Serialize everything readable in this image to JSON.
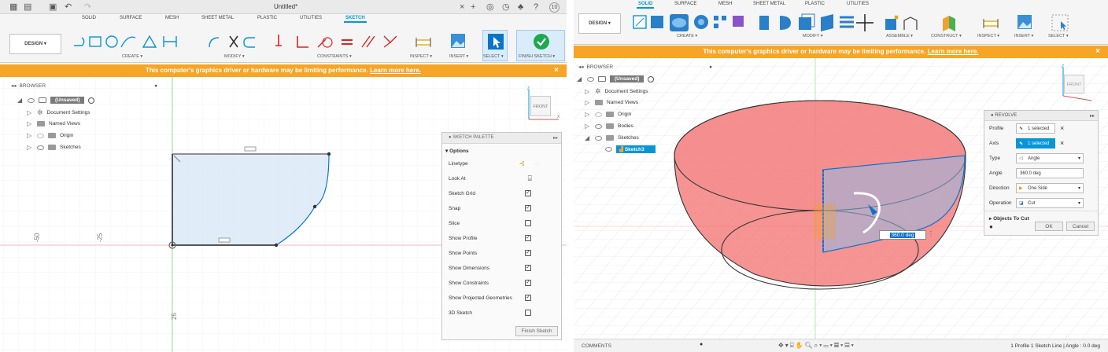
{
  "left": {
    "title": "Untitled*",
    "account": "10",
    "tabs": [
      "SOLID",
      "SURFACE",
      "MESH",
      "SHEET METAL",
      "PLASTIC",
      "UTILITIES",
      "SKETCH"
    ],
    "design_label": "DESIGN ▾",
    "groups": {
      "create": "CREATE ▾",
      "modify": "MODIFY ▾",
      "constraints": "CONSTRAINTS ▾",
      "inspect": "INSPECT ▾",
      "insert": "INSERT ▾",
      "select": "SELECT ▾",
      "finish": "FINISH SKETCH ▾"
    },
    "warning": "This computer's graphics driver or hardware may be limiting performance.",
    "warning_link": "Learn more here.",
    "browser_title": "BROWSER",
    "browser": [
      {
        "label": "(Unsaved)",
        "level": 0
      },
      {
        "label": "Document Settings",
        "level": 1
      },
      {
        "label": "Named Views",
        "level": 1
      },
      {
        "label": "Origin",
        "level": 1
      },
      {
        "label": "Sketches",
        "level": 1
      }
    ],
    "viewcube": "FRONT",
    "rulers": [
      "-50",
      "-25",
      "25"
    ],
    "palette": {
      "title": "SKETCH PALETTE",
      "section": "Options",
      "rows": [
        {
          "label": "Linetype",
          "kind": "icons"
        },
        {
          "label": "Look At",
          "kind": "icon"
        },
        {
          "label": "Sketch Grid",
          "kind": "check",
          "checked": true
        },
        {
          "label": "Snap",
          "kind": "check",
          "checked": true
        },
        {
          "label": "Slice",
          "kind": "check",
          "checked": false
        },
        {
          "label": "Show Profile",
          "kind": "check",
          "checked": true
        },
        {
          "label": "Show Points",
          "kind": "check",
          "checked": true
        },
        {
          "label": "Show Dimensions",
          "kind": "check",
          "checked": true
        },
        {
          "label": "Show Constraints",
          "kind": "check",
          "checked": true
        },
        {
          "label": "Show Projected Geometries",
          "kind": "check",
          "checked": true
        },
        {
          "label": "3D Sketch",
          "kind": "check",
          "checked": false
        }
      ],
      "finish": "Finish Sketch"
    }
  },
  "right": {
    "tabs": [
      "SOLID",
      "SURFACE",
      "MESH",
      "SHEET METAL",
      "PLASTIC",
      "UTILITIES"
    ],
    "design_label": "DESIGN ▾",
    "groups": {
      "create": "CREATE ▾",
      "modify": "MODIFY ▾",
      "assemble": "ASSEMBLE ▾",
      "construct": "CONSTRUCT ▾",
      "inspect": "INSPECT ▾",
      "insert": "INSERT ▾",
      "select": "SELECT ▾"
    },
    "warning": "This computer's graphics driver or hardware may be limiting performance.",
    "warning_link": "Learn more here.",
    "browser_title": "BROWSER",
    "browser": [
      {
        "label": "(Unsaved)",
        "level": 0
      },
      {
        "label": "Document Settings",
        "level": 1
      },
      {
        "label": "Named Views",
        "level": 1
      },
      {
        "label": "Origin",
        "level": 1
      },
      {
        "label": "Bodies",
        "level": 1
      },
      {
        "label": "Sketches",
        "level": 1
      },
      {
        "label": "Sketch3",
        "level": 2,
        "selected": true
      }
    ],
    "viewcube": "FRONT",
    "revolve": {
      "title": "REVOLVE",
      "rows": [
        {
          "label": "Profile",
          "value": "1 selected",
          "kind": "sel",
          "clear": true
        },
        {
          "label": "Axis",
          "value": "1 selected",
          "kind": "sel-active",
          "clear": true
        },
        {
          "label": "Type",
          "value": "Angle",
          "kind": "dropdown"
        },
        {
          "label": "Angle",
          "value": "360.0 deg",
          "kind": "input"
        },
        {
          "label": "Direction",
          "value": "One Side",
          "kind": "dropdown"
        },
        {
          "label": "Operation",
          "value": "Cut",
          "kind": "dropdown"
        }
      ],
      "objects": "Objects To Cut",
      "ok": "OK",
      "cancel": "Cancel"
    },
    "angle_input": "360.0 deg",
    "comments": "COMMENTS",
    "status": "1 Profile 1 Sketch Line | Angle : 0.0 deg"
  },
  "colors": {
    "accent": "#0696d7",
    "warning": "#f6a526",
    "cut": "#f26b6b",
    "finish": "#1fa84f"
  }
}
